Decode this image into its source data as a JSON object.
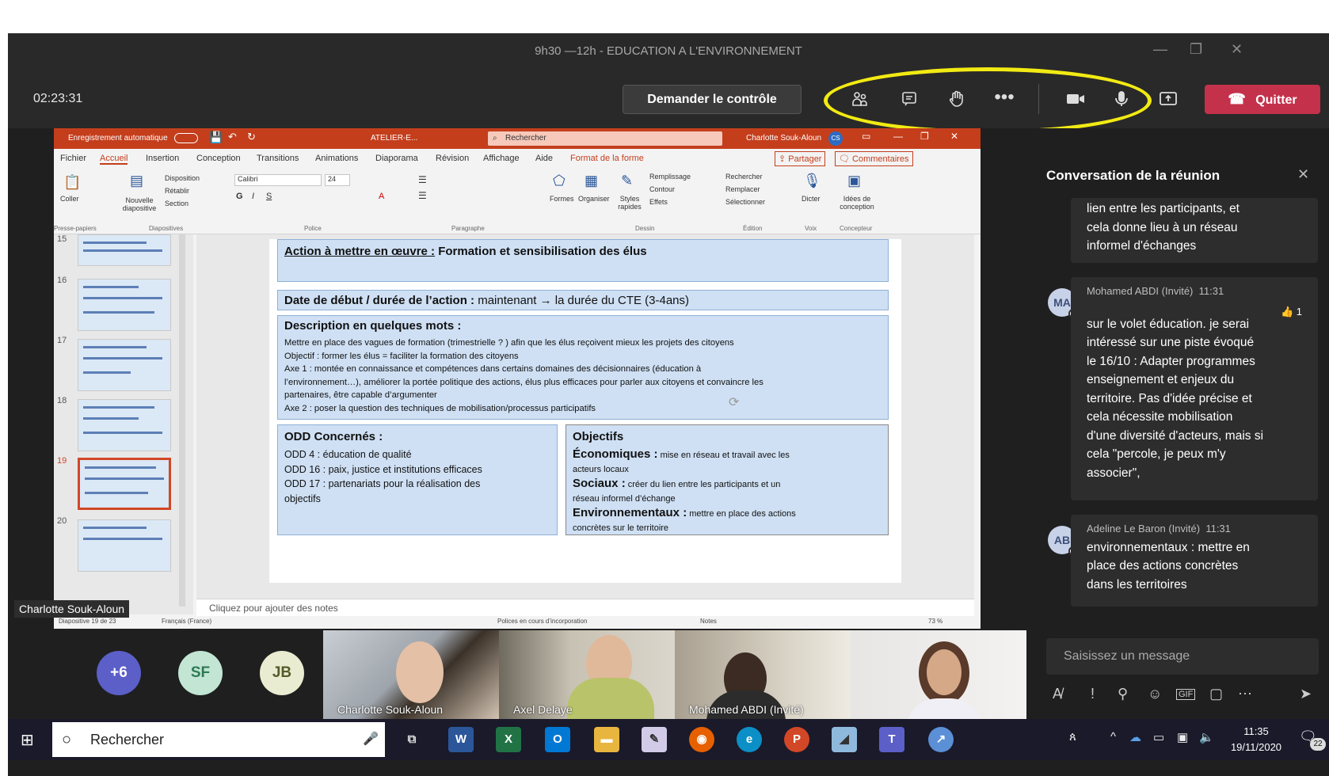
{
  "window": {
    "title": "9h30 —12h - EDUCATION A L'ENVIRONNEMENT"
  },
  "toolbar": {
    "timer": "02:23:31",
    "request_control": "Demander le contrôle",
    "quit": "Quitter"
  },
  "ppt": {
    "autosave": "Enregistrement automatique",
    "file": "ATELIER-E...",
    "search": "Rechercher",
    "user": "Charlotte Souk-Aloun",
    "user_initials": "CS",
    "tabs": [
      "Fichier",
      "Accueil",
      "Insertion",
      "Conception",
      "Transitions",
      "Animations",
      "Diaporama",
      "Révision",
      "Affichage",
      "Aide",
      "Format de la forme"
    ],
    "share": "Partager",
    "comments": "Commentaires",
    "ribbon": {
      "paste": "Coller",
      "new_slide": "Nouvelle diapositive",
      "layout": "Disposition",
      "reset": "Rétablir",
      "section": "Section",
      "font": "Calibri",
      "size": "24",
      "shapes": "Formes",
      "arrange": "Organiser",
      "styles": "Styles rapides",
      "fill": "Remplissage",
      "outline": "Contour",
      "effects": "Effets",
      "find": "Rechercher",
      "replace": "Remplacer",
      "select": "Sélectionner",
      "dictate": "Dicter",
      "designer": "Idées de conception",
      "groups": [
        "Presse-papiers",
        "Diapositives",
        "Police",
        "Paragraphe",
        "Dessin",
        "Édition",
        "Voix",
        "Concepteur"
      ]
    },
    "thumb_numbers": [
      "15",
      "16",
      "17",
      "18",
      "19",
      "20"
    ],
    "slide": {
      "action_label": "Action à mettre en œuvre :",
      "action_value": " Formation et sensibilisation des élus",
      "date_label": "Date de début / durée de l’action :",
      "date_value": " maintenant → la durée du CTE (3-4ans)",
      "desc_title": "Description en quelques mots :",
      "desc_lines": [
        "Mettre en place des vagues de formation (trimestrielle ? ) afin que les élus reçoivent mieux les projets des citoyens",
        "Objectif : former les élus = faciliter la formation des citoyens",
        "Axe 1 : montée en connaissance et compétences dans certains domaines des décisionnaires (éducation à",
        "l’environnement…), améliorer la portée politique des actions, élus plus efficaces pour parler aux citoyens et convaincre les",
        "partenaires, être capable d’argumenter",
        "Axe 2 : poser la question des techniques de mobilisation/processus participatifs"
      ],
      "odd_title": "ODD Concernés :",
      "odd_lines": [
        "ODD 4 : éducation de qualité",
        "ODD 16 : paix, justice et institutions efficaces",
        "ODD 17 : partenariats pour la réalisation des",
        "objectifs"
      ],
      "obj_title": "Objectifs",
      "obj_eco_label": "Économiques :",
      "obj_eco_text": " mise en réseau et travail avec les",
      "obj_eco_text2": "acteurs locaux",
      "obj_soc_label": "Sociaux :",
      "obj_soc_text": " créer du lien entre les participants et un",
      "obj_soc_text2": "réseau informel d’échange",
      "obj_env_label": "Environnementaux :",
      "obj_env_text": " mettre en place des actions",
      "obj_env_text2": "concrètes sur le territoire"
    },
    "notes": "Cliquez pour ajouter des notes",
    "status_slide": "Diapositive 19 de 23",
    "status_lang": "Français (France)",
    "status_fonts": "Polices en cours d’incorporation",
    "status_notes": "Notes",
    "status_zoom": "73 %"
  },
  "presenter_label": "Charlotte Souk-Aloun",
  "chat": {
    "title": "Conversation de la réunion",
    "msg0_lines": [
      "lien entre les participants, et",
      "cela donne lieu à un réseau",
      "informel d'échanges"
    ],
    "msg1": {
      "initials": "MA",
      "author": "Mohamed ABDI (Invité)",
      "time": "11:31",
      "reaction_count": "1",
      "lines": [
        "sur le volet éducation. je serai",
        "intéressé sur une piste évoqué",
        "le 16/10 : Adapter programmes",
        "enseignement et enjeux du",
        "territoire. Pas d'idée précise et",
        "cela nécessite mobilisation",
        "d'une diversité d'acteurs, mais si",
        "cela \"percole, je peux m'y",
        "associer\","
      ]
    },
    "msg2": {
      "initials": "AB",
      "author": "Adeline Le Baron (Invité)",
      "time": "11:31",
      "lines": [
        "environnementaux : mettre en",
        "place des actions concrètes",
        "dans les territoires"
      ]
    },
    "input_placeholder": "Saisissez un message"
  },
  "gallery": {
    "more": "+6",
    "sf": "SF",
    "jb": "JB",
    "videos": [
      "Charlotte Souk-Aloun",
      "Axel Delaye",
      "Mohamed ABDI (Invité)"
    ]
  },
  "taskbar": {
    "search": "Rechercher",
    "time": "11:35",
    "date": "19/11/2020",
    "notif": "22"
  },
  "colors": {
    "teams_red": "#c4314b",
    "ppt_orange": "#c43e1c",
    "highlight": "#f2ea13"
  }
}
